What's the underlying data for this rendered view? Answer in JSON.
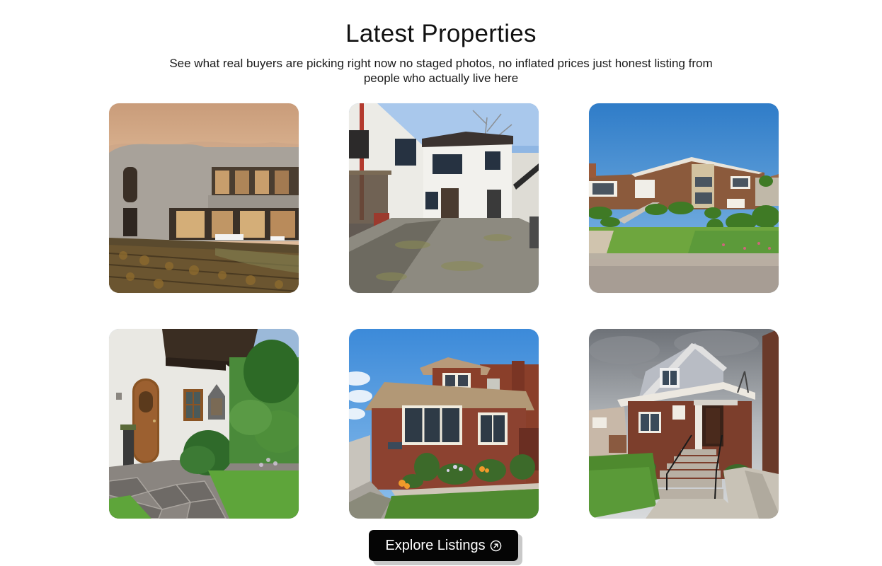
{
  "section": {
    "title": "Latest Properties",
    "subtitle": "See what real buyers are picking right now no staged photos, no inflated prices just honest listing from people who actually live here"
  },
  "properties": [
    {
      "image": "modern-curved-villa-at-sunset"
    },
    {
      "image": "white-townhouse-with-driveway"
    },
    {
      "image": "brick-split-level-house-with-lawn"
    },
    {
      "image": "alpine-chalet-entrance"
    },
    {
      "image": "brick-bungalow-with-flowers"
    },
    {
      "image": "brick-two-story-house-with-stairs"
    }
  ],
  "cta": {
    "label": "Explore Listings",
    "icon": "arrow-up-right-circle-icon"
  },
  "colors": {
    "background": "#ffffff",
    "button": "#050505",
    "button_text": "#ffffff",
    "button_shadow": "#c9c9c9"
  }
}
